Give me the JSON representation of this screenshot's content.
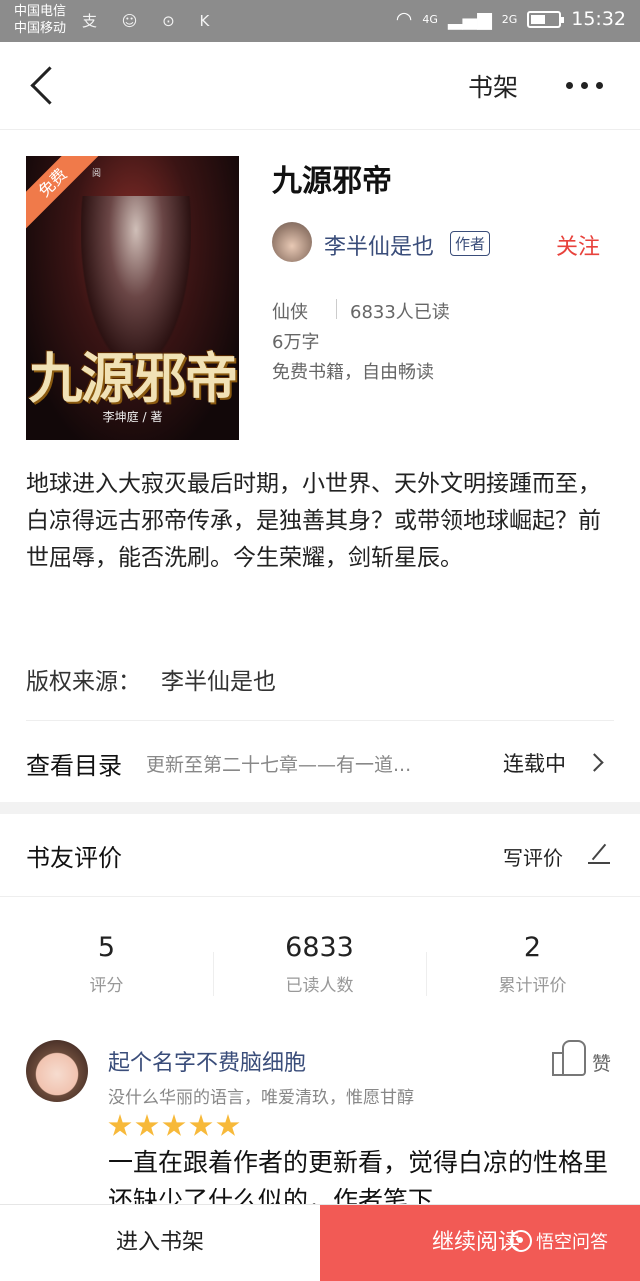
{
  "status_bar": {
    "carrier_1": "中国电信",
    "carrier_2": "中国移动",
    "left_icons": "支 ☺ ⊙ K",
    "network_1": "4G",
    "network_2": "2G",
    "battery_level": 0.55,
    "time": "15:32"
  },
  "nav": {
    "shelf_label": "书架",
    "more_glyph": "•••"
  },
  "book": {
    "cover_badge": "免费",
    "cover_publisher": "阅",
    "cover_title": "九源邪帝",
    "cover_author": "李坤庭 / 著",
    "title": "九源邪帝",
    "author": "李半仙是也",
    "author_tag": "作者",
    "follow_label": "关注",
    "genre": "仙侠",
    "readers": "6833人已读",
    "word_count": "6万字",
    "free_note": "免费书籍，自由畅读",
    "description": "地球进入大寂灭最后时期，小世界、天外文明接踵而至，白凉得远古邪帝传承，是独善其身？或带领地球崛起？前世屈辱，能否洗刷。今生荣耀，剑斩星辰。",
    "copyright_label": "版权来源：",
    "copyright_value": "李半仙是也"
  },
  "toc": {
    "label": "查看目录",
    "latest": "更新至第二十七章——有一道...",
    "status": "连载中"
  },
  "reviews": {
    "title": "书友评价",
    "write_label": "写评价",
    "stats": [
      {
        "value": "5",
        "label": "评分"
      },
      {
        "value": "6833",
        "label": "已读人数"
      },
      {
        "value": "2",
        "label": "累计评价"
      }
    ],
    "items": [
      {
        "name": "起个名字不费脑细胞",
        "bio": "没什么华丽的语言，唯爱清玖，惟愿甘醇",
        "rating": 5,
        "like_label": "赞",
        "text": "一直在跟着作者的更新看，觉得白凉的性格里还缺少了什么似的，作者笔下"
      }
    ]
  },
  "bottom_bar": {
    "shelf_button": "进入书架",
    "read_button": "继续阅读",
    "watermark": "悟空问答"
  },
  "colors": {
    "accent_red": "#f25a55",
    "follow_red": "#e8423c",
    "link_blue": "#3a4d7a",
    "star_gold": "#f7b93a"
  }
}
